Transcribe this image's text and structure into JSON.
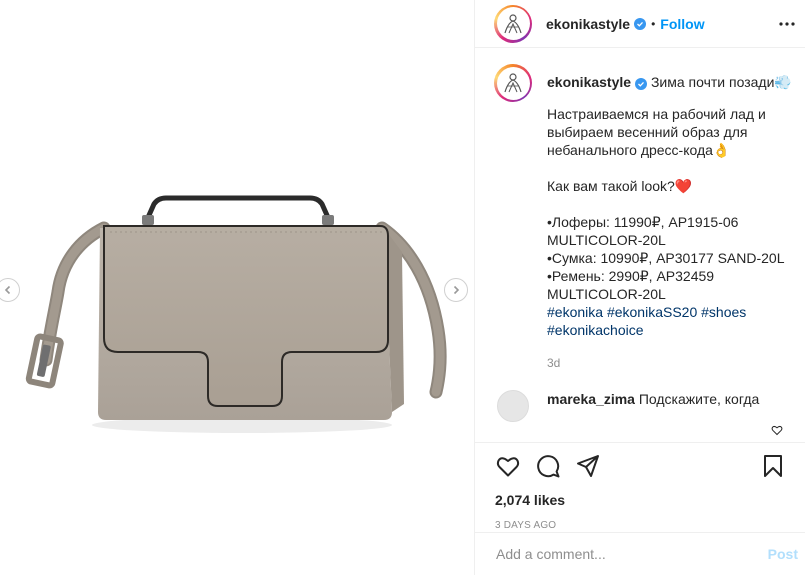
{
  "post": {
    "username": "ekonikastyle",
    "follow_label": "Follow",
    "dot": "•"
  },
  "caption": {
    "username": "ekonikastyle",
    "headline": "Зима почти позади💨",
    "body": "Настраиваемся на рабочий лад и выбираем весенний образ для небанального дресс-кода👌\n\nКак вам такой look?❤️\n\n•Лоферы: 11990₽, AP1915-06 MULTICOLOR-20L\n•Сумка: 10990₽, AP30177 SAND-20L\n•Ремень: 2990₽, AP32459 MULTICOLOR-20L\n",
    "hashtags": [
      "#ekonika",
      "#ekonikaSS20",
      "#shoes",
      "#ekonikachoice"
    ],
    "age": "3d"
  },
  "comment": {
    "username": "mareka_zima",
    "text": "Подскажите, когда"
  },
  "actions": {
    "likes": "2,074 likes",
    "date": "3 DAYS AGO"
  },
  "add_comment": {
    "placeholder": "Add a comment...",
    "post_label": "Post"
  },
  "icons": {
    "prev": "chevron-left-icon",
    "next": "chevron-right-icon",
    "like": "heart-icon",
    "comment": "comment-icon",
    "share": "share-icon",
    "save": "bookmark-icon",
    "more": "more-icon"
  },
  "colors": {
    "link": "#0095f6",
    "hashtag": "#003569",
    "verified": "#3897f0",
    "muted": "#8e8e8e",
    "post_disabled": "#b2dffc"
  }
}
